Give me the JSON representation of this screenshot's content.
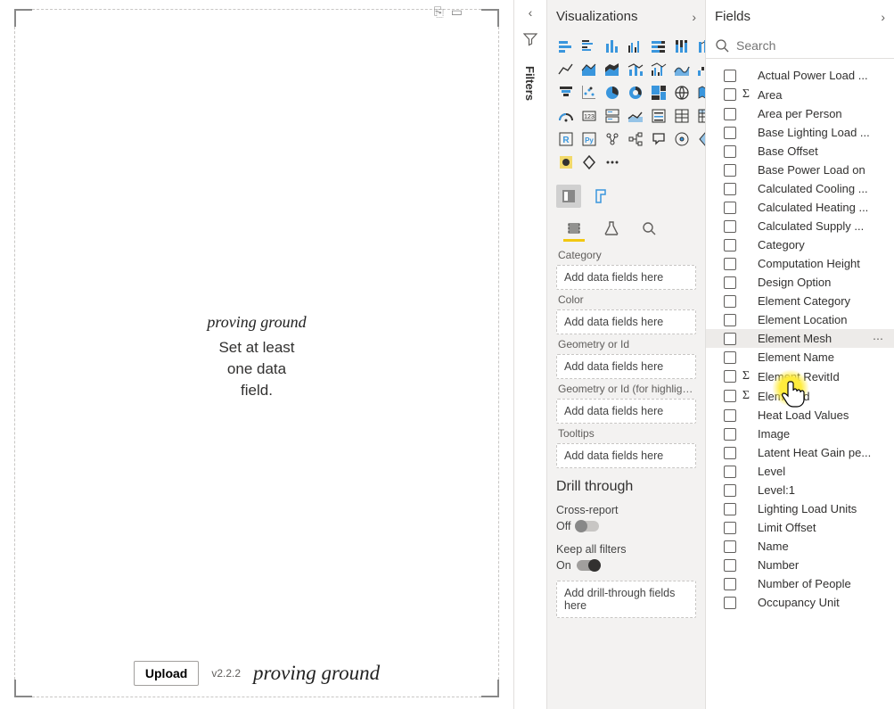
{
  "canvas": {
    "brand": "proving ground",
    "message_line1": "Set at least",
    "message_line2": "one data",
    "message_line3": "field.",
    "upload_label": "Upload",
    "version": "v2.2.2",
    "brand_footer": "proving ground"
  },
  "filters": {
    "label": "Filters"
  },
  "viz": {
    "title": "Visualizations",
    "wells": [
      {
        "label": "Category",
        "placeholder": "Add data fields here"
      },
      {
        "label": "Color",
        "placeholder": "Add data fields here"
      },
      {
        "label": "Geometry or Id",
        "placeholder": "Add data fields here"
      },
      {
        "label": "Geometry or Id (for highlight...",
        "placeholder": "Add data fields here"
      },
      {
        "label": "Tooltips",
        "placeholder": "Add data fields here"
      }
    ],
    "drill": {
      "header": "Drill through",
      "cross_label": "Cross-report",
      "cross_state": "Off",
      "keep_label": "Keep all filters",
      "keep_state": "On",
      "well_placeholder": "Add drill-through fields here"
    }
  },
  "fields": {
    "title": "Fields",
    "search_placeholder": "Search",
    "items": [
      {
        "name": "Actual Power Load ...",
        "sigma": false
      },
      {
        "name": "Area",
        "sigma": true
      },
      {
        "name": "Area per Person",
        "sigma": false
      },
      {
        "name": "Base Lighting Load ...",
        "sigma": false
      },
      {
        "name": "Base Offset",
        "sigma": false
      },
      {
        "name": "Base Power Load on",
        "sigma": false
      },
      {
        "name": "Calculated Cooling ...",
        "sigma": false
      },
      {
        "name": "Calculated Heating ...",
        "sigma": false
      },
      {
        "name": "Calculated Supply ...",
        "sigma": false
      },
      {
        "name": "Category",
        "sigma": false
      },
      {
        "name": "Computation Height",
        "sigma": false
      },
      {
        "name": "Design Option",
        "sigma": false
      },
      {
        "name": "Element Category",
        "sigma": false
      },
      {
        "name": "Element Location",
        "sigma": false
      },
      {
        "name": "Element Mesh",
        "sigma": false,
        "hovered": true
      },
      {
        "name": "Element Name",
        "sigma": false
      },
      {
        "name": "Element RevitId",
        "sigma": true
      },
      {
        "name": "ElementId",
        "sigma": true
      },
      {
        "name": "Heat Load Values",
        "sigma": false
      },
      {
        "name": "Image",
        "sigma": false
      },
      {
        "name": "Latent Heat Gain pe...",
        "sigma": false
      },
      {
        "name": "Level",
        "sigma": false
      },
      {
        "name": "Level:1",
        "sigma": false
      },
      {
        "name": "Lighting Load Units",
        "sigma": false
      },
      {
        "name": "Limit Offset",
        "sigma": false
      },
      {
        "name": "Name",
        "sigma": false
      },
      {
        "name": "Number",
        "sigma": false
      },
      {
        "name": "Number of People",
        "sigma": false
      },
      {
        "name": "Occupancy Unit",
        "sigma": false
      }
    ]
  }
}
